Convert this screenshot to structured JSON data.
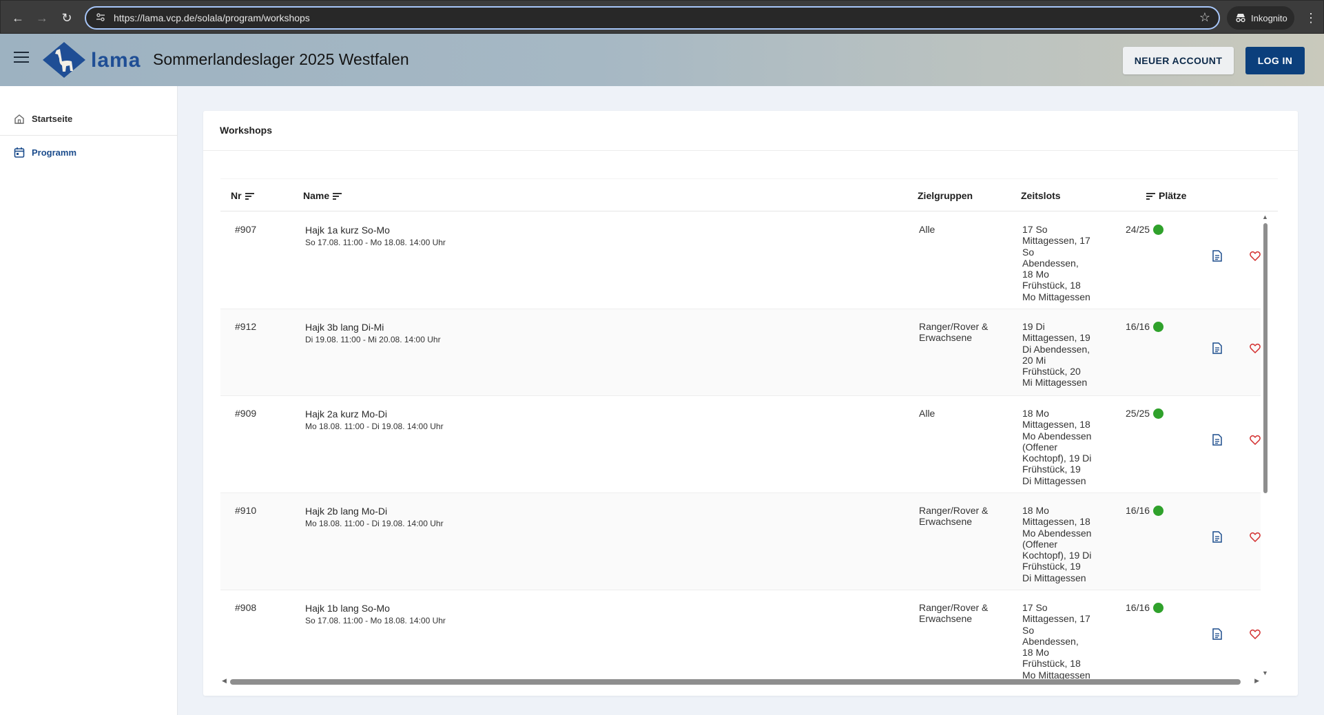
{
  "browser": {
    "url": "https://lama.vcp.de/solala/program/workshops",
    "incognito_label": "Inkognito"
  },
  "header": {
    "logo_text": "lama",
    "title": "Sommerlandeslager 2025 Westfalen",
    "new_account_label": "NEUER ACCOUNT",
    "login_label": "LOG IN"
  },
  "sidebar": {
    "items": [
      {
        "label": "Startseite",
        "icon": "home-icon"
      },
      {
        "label": "Programm",
        "icon": "calendar-icon"
      }
    ]
  },
  "card": {
    "title": "Workshops"
  },
  "table": {
    "columns": {
      "nr": "Nr",
      "name": "Name",
      "zielgruppen": "Zielgruppen",
      "zeitslots": "Zeitslots",
      "plaetze": "Plätze"
    },
    "rows": [
      {
        "nr": "#907",
        "name": "Hajk 1a kurz So-Mo",
        "date": "So 17.08. 11:00 - Mo 18.08. 14:00 Uhr",
        "zielgruppen": [
          "Alle"
        ],
        "zeitslots": [
          "17 So",
          "Mittagessen, 17",
          "So",
          "Abendessen,",
          "18 Mo",
          "Frühstück, 18",
          "Mo Mittagessen"
        ],
        "plaetze": "24/25"
      },
      {
        "nr": "#912",
        "name": "Hajk 3b lang Di-Mi",
        "date": "Di 19.08. 11:00 - Mi 20.08. 14:00 Uhr",
        "zielgruppen": [
          "Ranger/Rover &",
          "Erwachsene"
        ],
        "zeitslots": [
          "19 Di",
          "Mittagessen, 19",
          "Di Abendessen,",
          "20 Mi",
          "Frühstück, 20",
          "Mi Mittagessen"
        ],
        "plaetze": "16/16"
      },
      {
        "nr": "#909",
        "name": "Hajk 2a kurz Mo-Di",
        "date": "Mo 18.08. 11:00 - Di 19.08. 14:00 Uhr",
        "zielgruppen": [
          "Alle"
        ],
        "zeitslots": [
          "18 Mo",
          "Mittagessen, 18",
          "Mo Abendessen",
          "(Offener",
          "Kochtopf), 19 Di",
          "Frühstück, 19",
          "Di Mittagessen"
        ],
        "plaetze": "25/25"
      },
      {
        "nr": "#910",
        "name": "Hajk 2b lang Mo-Di",
        "date": "Mo 18.08. 11:00 - Di 19.08. 14:00 Uhr",
        "zielgruppen": [
          "Ranger/Rover &",
          "Erwachsene"
        ],
        "zeitslots": [
          "18 Mo",
          "Mittagessen, 18",
          "Mo Abendessen",
          "(Offener",
          "Kochtopf), 19 Di",
          "Frühstück, 19",
          "Di Mittagessen"
        ],
        "plaetze": "16/16"
      },
      {
        "nr": "#908",
        "name": "Hajk 1b lang So-Mo",
        "date": "So 17.08. 11:00 - Mo 18.08. 14:00 Uhr",
        "zielgruppen": [
          "Ranger/Rover &",
          "Erwachsene"
        ],
        "zeitslots": [
          "17 So",
          "Mittagessen, 17",
          "So",
          "Abendessen,",
          "18 Mo",
          "Frühstück, 18",
          "Mo Mittagessen"
        ],
        "plaetze": "16/16"
      }
    ]
  },
  "colors": {
    "primary": "#0b3f7c",
    "available_dot": "#2fa12b",
    "heart": "#d32f2f",
    "doc_icon": "#1b4c8c"
  }
}
